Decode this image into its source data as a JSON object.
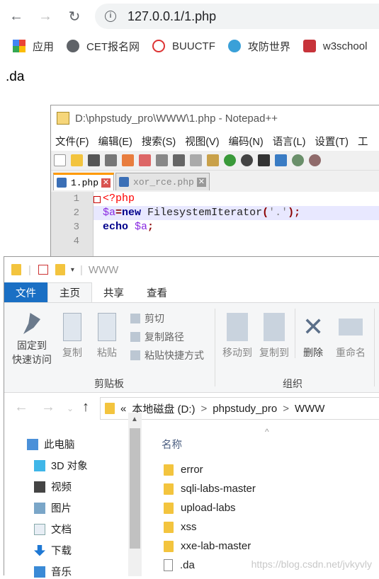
{
  "browser": {
    "url": "127.0.0.1/1.php",
    "bookmarks": [
      "应用",
      "CET报名网",
      "BUUCTF",
      "攻防世界",
      "w3school"
    ],
    "page_text": ".da"
  },
  "notepad": {
    "title": "D:\\phpstudy_pro\\WWW\\1.php - Notepad++",
    "menu": [
      "文件(F)",
      "编辑(E)",
      "搜索(S)",
      "视图(V)",
      "编码(N)",
      "语言(L)",
      "设置(T)",
      "工"
    ],
    "tabs": [
      {
        "label": "1.php",
        "active": true
      },
      {
        "label": "xor_rce.php",
        "active": false
      }
    ],
    "line_numbers": [
      "1",
      "2",
      "3",
      "4"
    ],
    "code": {
      "l1": "<?php",
      "l2_var": "$a",
      "l2_eq": "=",
      "l2_new": "new",
      "l2_cls": " FilesystemIterator",
      "l2_open": "(",
      "l2_str": "'.'",
      "l2_close": ");",
      "l3_echo": "echo",
      "l3_var": " $a",
      "l3_end": ";"
    }
  },
  "explorer": {
    "title": "WWW",
    "ribbon_tabs": [
      "文件",
      "主页",
      "共享",
      "查看"
    ],
    "clipboard": {
      "pin": "固定到\n快速访问",
      "copy": "复制",
      "paste": "粘贴",
      "cut": "剪切",
      "copy_path": "复制路径",
      "paste_shortcut": "粘贴快捷方式",
      "group": "剪贴板"
    },
    "organize": {
      "move_to": "移动到",
      "copy_to": "复制到",
      "delete": "删除",
      "rename": "重命名",
      "group": "组织"
    },
    "breadcrumb": [
      "«",
      "本地磁盘 (D:)",
      ">",
      "phpstudy_pro",
      ">",
      "WWW"
    ],
    "nav_items": [
      "此电脑",
      "3D 对象",
      "视频",
      "图片",
      "文档",
      "下载",
      "音乐"
    ],
    "column_name": "名称",
    "files": [
      {
        "name": "error",
        "type": "folder"
      },
      {
        "name": "sqli-labs-master",
        "type": "folder"
      },
      {
        "name": "upload-labs",
        "type": "folder"
      },
      {
        "name": "xss",
        "type": "folder"
      },
      {
        "name": "xxe-lab-master",
        "type": "folder"
      },
      {
        "name": ".da",
        "type": "file"
      }
    ]
  },
  "watermark": "https://blog.csdn.net/jvkyvly"
}
